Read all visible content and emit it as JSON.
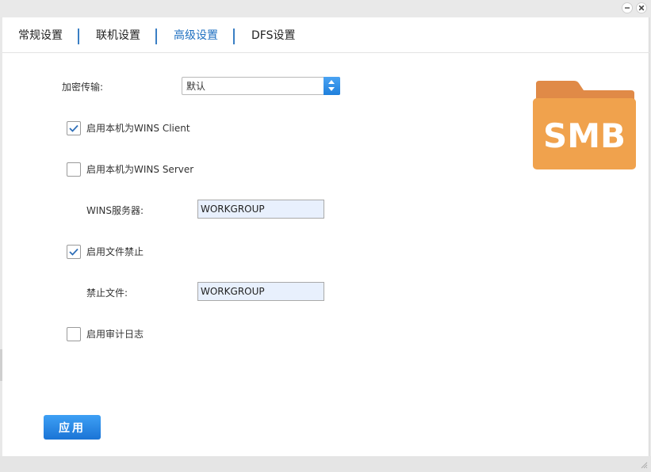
{
  "window_controls": {
    "minimize_icon": "minimize-icon",
    "close_icon": "close-icon"
  },
  "tabs": [
    {
      "label": "常规设置",
      "active": false
    },
    {
      "label": "联机设置",
      "active": false
    },
    {
      "label": "高级设置",
      "active": true
    },
    {
      "label": "DFS设置",
      "active": false
    }
  ],
  "form": {
    "encryption_label": "加密传输:",
    "encryption_value": "默认",
    "wins_client": {
      "label": "启用本机为WINS Client",
      "checked": true
    },
    "wins_server": {
      "label": "启用本机为WINS Server",
      "checked": false
    },
    "wins_server_field_label": "WINS服务器:",
    "wins_server_value": "WORKGROUP",
    "file_block": {
      "label": "启用文件禁止",
      "checked": true
    },
    "blocked_files_label": "禁止文件:",
    "blocked_files_value": "WORKGROUP",
    "audit_log": {
      "label": "启用审计日志",
      "checked": false
    }
  },
  "apply_label": "应用",
  "logo": {
    "text": "SMB",
    "color": "#f0a24d",
    "tab_color": "#e08a47"
  },
  "colors": {
    "accent": "#1e6fc0",
    "button": "#2a8bea",
    "checkmark": "#2f6fb8"
  }
}
